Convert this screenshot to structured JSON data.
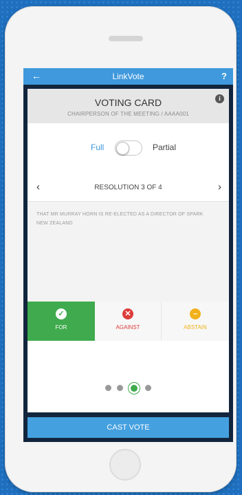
{
  "app": {
    "title": "LinkVote",
    "back_icon": "back-arrow-icon",
    "help_label": "?"
  },
  "card": {
    "title": "VOTING CARD",
    "subtitle": "CHAIRPERSON OF THE MEETING / AAAA001",
    "info_label": "i"
  },
  "toggle": {
    "left_label": "Full",
    "right_label": "Partial",
    "selected": "Full"
  },
  "resolution": {
    "prev_label": "‹",
    "next_label": "›",
    "label": "RESOLUTION 3 OF 4",
    "text": "THAT MR MURRAY HORN IS RE-ELECTED AS A DIRECTOR OF SPARK NEW ZEALAND"
  },
  "options": [
    {
      "label": "FOR",
      "icon": "check-icon",
      "glyph": "✓",
      "selected": true,
      "color": "#3fab4e"
    },
    {
      "label": "AGAINST",
      "icon": "x-icon",
      "glyph": "✕",
      "selected": false,
      "color": "#dd3b3b"
    },
    {
      "label": "ABSTAIN",
      "icon": "minus-icon",
      "glyph": "–",
      "selected": false,
      "color": "#f2b11a"
    }
  ],
  "pagination": {
    "total": 4,
    "current": 3
  },
  "cast_button": "CAST VOTE",
  "colors": {
    "accent": "#3f99dc",
    "for": "#3fab4e",
    "against": "#dd3b3b",
    "abstain": "#f2b11a"
  }
}
